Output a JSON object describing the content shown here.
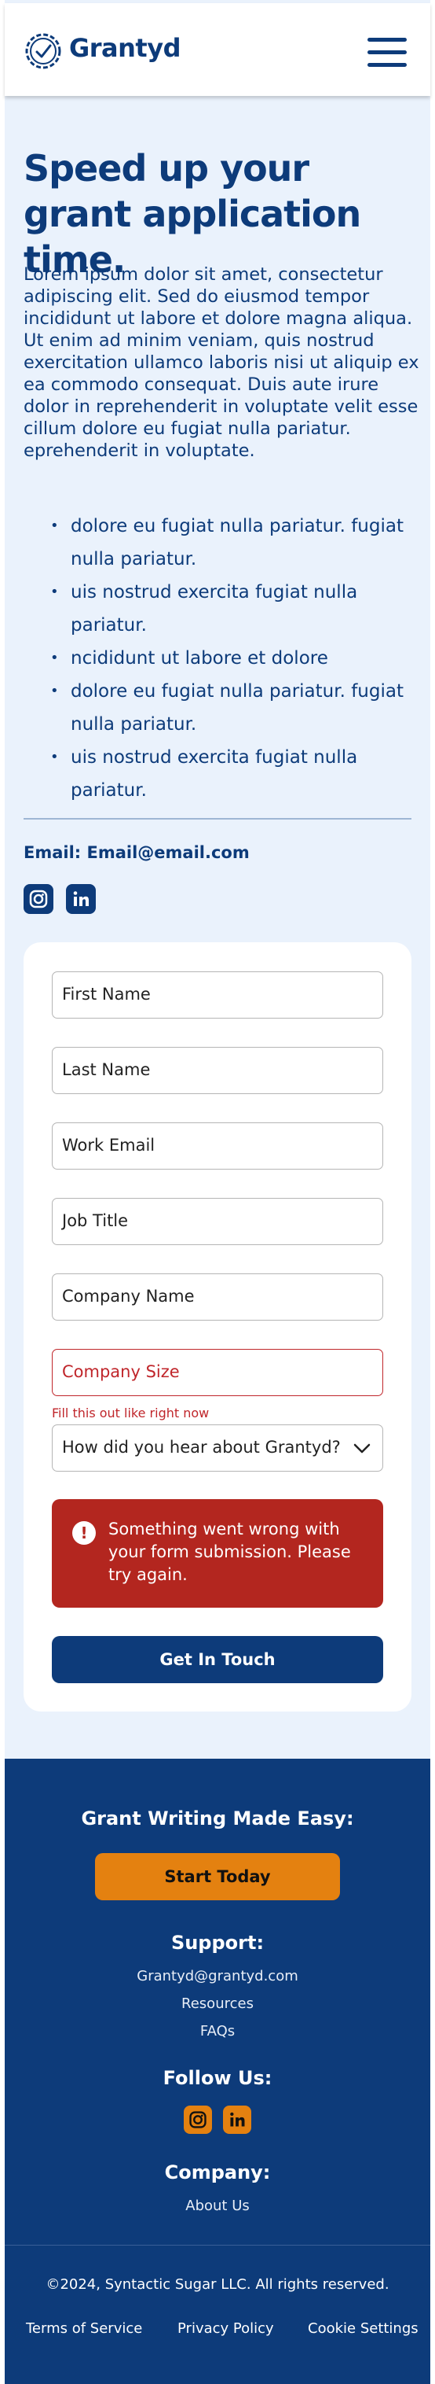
{
  "header": {
    "brand": "Grantyd",
    "menu_icon": "hamburger-menu-icon",
    "logo_icon": "badge-check-icon"
  },
  "hero": {
    "title": "Speed up your grant application time.",
    "body": "Lorem ipsum dolor sit amet, consectetur adipiscing elit. Sed do eiusmod tempor incididunt ut labore et dolore magna aliqua. Ut enim ad minim veniam, quis nostrud exercitation ullamco laboris nisi ut aliquip ex ea commodo consequat. Duis aute irure dolor in reprehenderit in voluptate velit esse cillum dolore eu fugiat nulla pariatur. eprehenderit in voluptate.",
    "bullets": [
      "dolore eu fugiat nulla pariatur.  fugiat nulla pariatur.",
      "uis nostrud exercita  fugiat nulla pariatur.",
      "ncididunt ut labore et dolore",
      "dolore eu fugiat nulla pariatur. fugiat nulla pariatur.",
      "uis nostrud exercita fugiat nulla pariatur."
    ],
    "email": "Email: Email@email.com"
  },
  "form": {
    "first_name": "First Name",
    "last_name": "Last Name",
    "work_email": "Work Email",
    "job_title": "Job Title",
    "company_name": "Company Name",
    "company_size": "Company Size",
    "company_size_error": "Fill this out like right now",
    "heard_about": "How did you hear about Grantyd?",
    "error_message": "Something went wrong with your form submission. Please try again.",
    "submit_label": "Get In Touch"
  },
  "footer": {
    "tagline": "Grant Writing Made Easy:",
    "cta_label": "Start Today",
    "support_heading": "Support:",
    "support_email": "Grantyd@grantyd.com",
    "resources": "Resources",
    "faqs": "FAQs",
    "follow_heading": "Follow Us:",
    "company_heading": "Company:",
    "about": "About Us",
    "copyright": "©2024, Syntactic Sugar LLC. All rights reserved.",
    "terms": "Terms of Service",
    "privacy": "Privacy Policy",
    "cookie": "Cookie Settings"
  },
  "colors": {
    "brand_navy": "#0d3b7a",
    "page_bg": "#eaf2fc",
    "accent_orange": "#e48110",
    "error_red": "#c0262b",
    "alert_red": "#b3261f"
  }
}
